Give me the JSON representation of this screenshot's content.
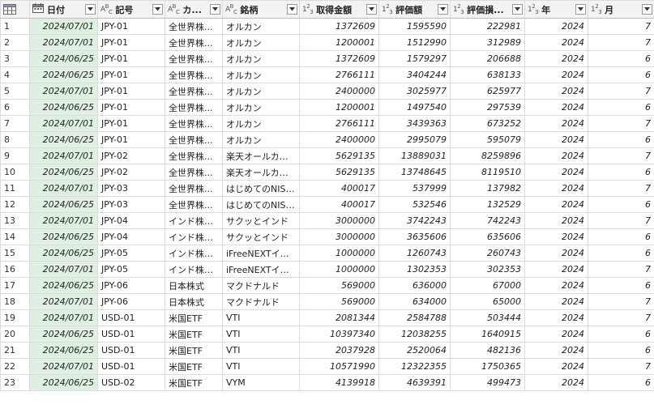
{
  "columns": [
    {
      "name": "日付",
      "type": "date"
    },
    {
      "name": "記号",
      "type": "ABC"
    },
    {
      "name": "カ...",
      "type": "ABC"
    },
    {
      "name": "銘柄",
      "type": "ABC"
    },
    {
      "name": "取得金額",
      "type": "123"
    },
    {
      "name": "評価額",
      "type": "123"
    },
    {
      "name": "評価損...",
      "type": "123"
    },
    {
      "name": "年",
      "type": "123"
    },
    {
      "name": "月",
      "type": "123"
    }
  ],
  "rows": [
    {
      "n": "1",
      "date": "2024/07/01",
      "code": "JPY-01",
      "cat": "全世界株...",
      "name": "オルカン",
      "cost": "1372609",
      "value": "1595590",
      "gain": "222981",
      "year": "2024",
      "month": "7"
    },
    {
      "n": "2",
      "date": "2024/07/01",
      "code": "JPY-01",
      "cat": "全世界株...",
      "name": "オルカン",
      "cost": "1200001",
      "value": "1512990",
      "gain": "312989",
      "year": "2024",
      "month": "7"
    },
    {
      "n": "3",
      "date": "2024/06/25",
      "code": "JPY-01",
      "cat": "全世界株...",
      "name": "オルカン",
      "cost": "1372609",
      "value": "1579297",
      "gain": "206688",
      "year": "2024",
      "month": "6"
    },
    {
      "n": "4",
      "date": "2024/06/25",
      "code": "JPY-01",
      "cat": "全世界株...",
      "name": "オルカン",
      "cost": "2766111",
      "value": "3404244",
      "gain": "638133",
      "year": "2024",
      "month": "6"
    },
    {
      "n": "5",
      "date": "2024/07/01",
      "code": "JPY-01",
      "cat": "全世界株...",
      "name": "オルカン",
      "cost": "2400000",
      "value": "3025977",
      "gain": "625977",
      "year": "2024",
      "month": "7"
    },
    {
      "n": "6",
      "date": "2024/06/25",
      "code": "JPY-01",
      "cat": "全世界株...",
      "name": "オルカン",
      "cost": "1200001",
      "value": "1497540",
      "gain": "297539",
      "year": "2024",
      "month": "6"
    },
    {
      "n": "7",
      "date": "2024/07/01",
      "code": "JPY-01",
      "cat": "全世界株...",
      "name": "オルカン",
      "cost": "2766111",
      "value": "3439363",
      "gain": "673252",
      "year": "2024",
      "month": "7"
    },
    {
      "n": "8",
      "date": "2024/06/25",
      "code": "JPY-01",
      "cat": "全世界株...",
      "name": "オルカン",
      "cost": "2400000",
      "value": "2995079",
      "gain": "595079",
      "year": "2024",
      "month": "6"
    },
    {
      "n": "9",
      "date": "2024/07/01",
      "code": "JPY-02",
      "cat": "全世界株...",
      "name": "楽天オールカン...",
      "cost": "5629135",
      "value": "13889031",
      "gain": "8259896",
      "year": "2024",
      "month": "7"
    },
    {
      "n": "10",
      "date": "2024/06/25",
      "code": "JPY-02",
      "cat": "全世界株...",
      "name": "楽天オールカン...",
      "cost": "5629135",
      "value": "13748645",
      "gain": "8119510",
      "year": "2024",
      "month": "6"
    },
    {
      "n": "11",
      "date": "2024/07/01",
      "code": "JPY-03",
      "cat": "全世界株...",
      "name": "はじめてのNISA...",
      "cost": "400017",
      "value": "537999",
      "gain": "137982",
      "year": "2024",
      "month": "7"
    },
    {
      "n": "12",
      "date": "2024/06/25",
      "code": "JPY-03",
      "cat": "全世界株...",
      "name": "はじめてのNISA...",
      "cost": "400017",
      "value": "532546",
      "gain": "132529",
      "year": "2024",
      "month": "6"
    },
    {
      "n": "13",
      "date": "2024/07/01",
      "code": "JPY-04",
      "cat": "インド株式...",
      "name": "サクッとインド",
      "cost": "3000000",
      "value": "3742243",
      "gain": "742243",
      "year": "2024",
      "month": "7"
    },
    {
      "n": "14",
      "date": "2024/06/25",
      "code": "JPY-04",
      "cat": "インド株式...",
      "name": "サクッとインド",
      "cost": "3000000",
      "value": "3635606",
      "gain": "635606",
      "year": "2024",
      "month": "6"
    },
    {
      "n": "15",
      "date": "2024/06/25",
      "code": "JPY-05",
      "cat": "インド株式...",
      "name": "iFreeNEXTインド",
      "cost": "1000000",
      "value": "1260743",
      "gain": "260743",
      "year": "2024",
      "month": "6"
    },
    {
      "n": "16",
      "date": "2024/07/01",
      "code": "JPY-05",
      "cat": "インド株式...",
      "name": "iFreeNEXTインド",
      "cost": "1000000",
      "value": "1302353",
      "gain": "302353",
      "year": "2024",
      "month": "7"
    },
    {
      "n": "17",
      "date": "2024/06/25",
      "code": "JPY-06",
      "cat": "日本株式",
      "name": "マクドナルド",
      "cost": "569000",
      "value": "636000",
      "gain": "67000",
      "year": "2024",
      "month": "6"
    },
    {
      "n": "18",
      "date": "2024/07/01",
      "code": "JPY-06",
      "cat": "日本株式",
      "name": "マクドナルド",
      "cost": "569000",
      "value": "634000",
      "gain": "65000",
      "year": "2024",
      "month": "7"
    },
    {
      "n": "19",
      "date": "2024/07/01",
      "code": "USD-01",
      "cat": "米国ETF",
      "name": "VTI",
      "cost": "2081344",
      "value": "2584788",
      "gain": "503444",
      "year": "2024",
      "month": "7"
    },
    {
      "n": "20",
      "date": "2024/06/25",
      "code": "USD-01",
      "cat": "米国ETF",
      "name": "VTI",
      "cost": "10397340",
      "value": "12038255",
      "gain": "1640915",
      "year": "2024",
      "month": "6"
    },
    {
      "n": "21",
      "date": "2024/06/25",
      "code": "USD-01",
      "cat": "米国ETF",
      "name": "VTI",
      "cost": "2037928",
      "value": "2520064",
      "gain": "482136",
      "year": "2024",
      "month": "6"
    },
    {
      "n": "22",
      "date": "2024/07/01",
      "code": "USD-01",
      "cat": "米国ETF",
      "name": "VTI",
      "cost": "10571990",
      "value": "12322355",
      "gain": "1750365",
      "year": "2024",
      "month": "7"
    },
    {
      "n": "23",
      "date": "2024/06/25",
      "code": "USD-02",
      "cat": "米国ETF",
      "name": "VYM",
      "cost": "4139918",
      "value": "4639391",
      "gain": "499473",
      "year": "2024",
      "month": "6"
    }
  ],
  "colors": {
    "header_bg": "#f3f3f3",
    "date_col_bg": "#dff0e3",
    "grid_line": "#dcdcdc"
  }
}
